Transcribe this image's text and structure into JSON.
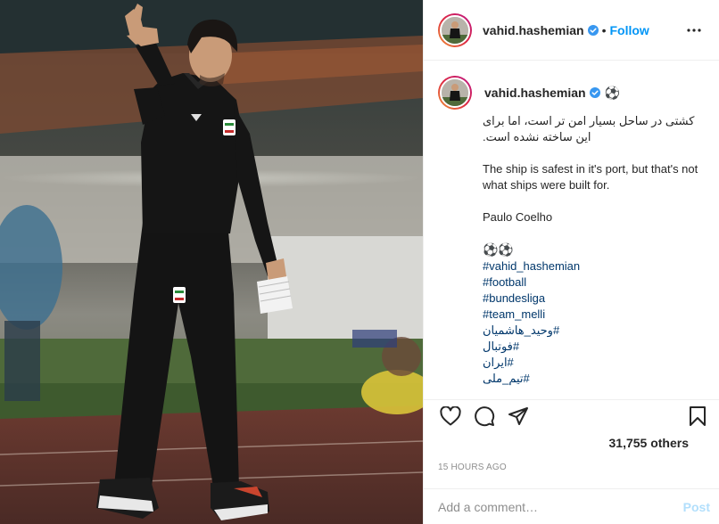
{
  "header": {
    "username": "vahid.hashemian",
    "separator": "•",
    "follow_label": "Follow",
    "more_icon": "more-horizontal-icon"
  },
  "caption": {
    "username": "vahid.hashemian",
    "emoji": "⚽",
    "persian_line": "کشتی در ساحل بسیار امن تر است، اما برای این ساخته نشده است.",
    "english_line": "The ship is safest in it's port, but that's not what ships were built for.",
    "author": "Paulo Coelho",
    "emoji_pair": "⚽⚽",
    "hashtags": [
      "#vahid_hashemian",
      "#football",
      "#bundesliga",
      "#team_melli",
      "#وحید_هاشمیان",
      "#فوتبال",
      "#ایران",
      "#تیم_ملی"
    ]
  },
  "actions": {
    "like_icon": "heart-icon",
    "comment_icon": "comment-icon",
    "share_icon": "share-icon",
    "save_icon": "bookmark-icon"
  },
  "likes_label": "31,755 others",
  "timestamp": "15 HOURS AGO",
  "comment_box": {
    "placeholder": "Add a comment…",
    "post_label": "Post"
  },
  "colors": {
    "link": "#0095f6",
    "hashtag": "#00376b",
    "muted": "#8e8e8e",
    "post_disabled": "#b2dffc"
  }
}
